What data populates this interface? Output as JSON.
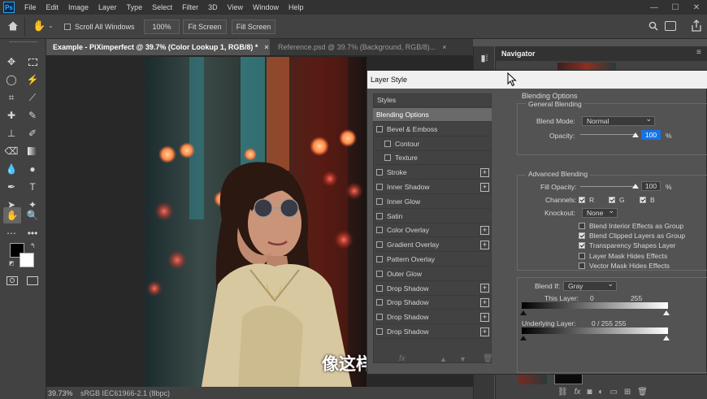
{
  "menu": {
    "logo": "Ps",
    "items": [
      "File",
      "Edit",
      "Image",
      "Layer",
      "Type",
      "Select",
      "Filter",
      "3D",
      "View",
      "Window",
      "Help"
    ]
  },
  "window_controls": [
    "—",
    "☐",
    "✕"
  ],
  "options": {
    "scroll_all_windows": "Scroll All Windows",
    "zoom_100": "100%",
    "fit_screen": "Fit Screen",
    "fill_screen": "Fill Screen"
  },
  "tabs": [
    {
      "label": "Example - PiXimperfect @ 39.7% (Color Lookup 1, RGB/8) *",
      "close": "×"
    },
    {
      "label": "Reference.psd @ 39.7% (Background, RGB/8)...",
      "close": "×"
    }
  ],
  "status": {
    "zoom": "39.73%",
    "profile": "sRGB IEC61966-2.1 (8bpc)"
  },
  "navigator": {
    "title": "Navigator",
    "menu_icon": "≡"
  },
  "dialog": {
    "title": "Layer Style",
    "styles_header": "Styles",
    "styles": [
      {
        "label": "Blending Options",
        "active": true,
        "checkbox": false,
        "plus": false,
        "indent": false
      },
      {
        "label": "Bevel & Emboss",
        "checkbox": true,
        "plus": false,
        "indent": false
      },
      {
        "label": "Contour",
        "checkbox": true,
        "plus": false,
        "indent": true
      },
      {
        "label": "Texture",
        "checkbox": true,
        "plus": false,
        "indent": true
      },
      {
        "label": "Stroke",
        "checkbox": true,
        "plus": true,
        "indent": false
      },
      {
        "label": "Inner Shadow",
        "checkbox": true,
        "plus": true,
        "indent": false
      },
      {
        "label": "Inner Glow",
        "checkbox": true,
        "plus": false,
        "indent": false
      },
      {
        "label": "Satin",
        "checkbox": true,
        "plus": false,
        "indent": false
      },
      {
        "label": "Color Overlay",
        "checkbox": true,
        "plus": true,
        "indent": false
      },
      {
        "label": "Gradient Overlay",
        "checkbox": true,
        "plus": true,
        "indent": false
      },
      {
        "label": "Pattern Overlay",
        "checkbox": true,
        "plus": false,
        "indent": false
      },
      {
        "label": "Outer Glow",
        "checkbox": true,
        "plus": false,
        "indent": false
      },
      {
        "label": "Drop Shadow",
        "checkbox": true,
        "plus": true,
        "indent": false
      },
      {
        "label": "Drop Shadow",
        "checkbox": true,
        "plus": true,
        "indent": false
      },
      {
        "label": "Drop Shadow",
        "checkbox": true,
        "plus": true,
        "indent": false
      },
      {
        "label": "Drop Shadow",
        "checkbox": true,
        "plus": true,
        "indent": false
      }
    ],
    "blending": {
      "header": "Blending Options",
      "general": "General Blending",
      "blend_mode_label": "Blend Mode:",
      "blend_mode": "Normal",
      "opacity_label": "Opacity:",
      "opacity": "100",
      "percent": "%",
      "advanced": "Advanced Blending",
      "fill_opacity_label": "Fill Opacity:",
      "fill_opacity": "100",
      "channels_label": "Channels:",
      "channel_r": "R",
      "channel_g": "G",
      "channel_b": "B",
      "knockout_label": "Knockout:",
      "knockout": "None",
      "options": [
        {
          "label": "Blend Interior Effects as Group",
          "checked": false
        },
        {
          "label": "Blend Clipped Layers as Group",
          "checked": true
        },
        {
          "label": "Transparency Shapes Layer",
          "checked": true
        },
        {
          "label": "Layer Mask Hides Effects",
          "checked": false
        },
        {
          "label": "Vector Mask Hides Effects",
          "checked": false
        }
      ],
      "blend_if_label": "Blend If:",
      "blend_if": "Gray",
      "this_layer_label": "This Layer:",
      "this_layer_low": "0",
      "this_layer_high": "255",
      "underlying_label": "Underlying Layer:",
      "underlying_values": "0   /  255   255"
    }
  },
  "subtitle": "像这样",
  "colors": {
    "accent": "#31a8ff",
    "panel": "#424242",
    "dialog": "#535353",
    "highlight": "#1473e6"
  }
}
